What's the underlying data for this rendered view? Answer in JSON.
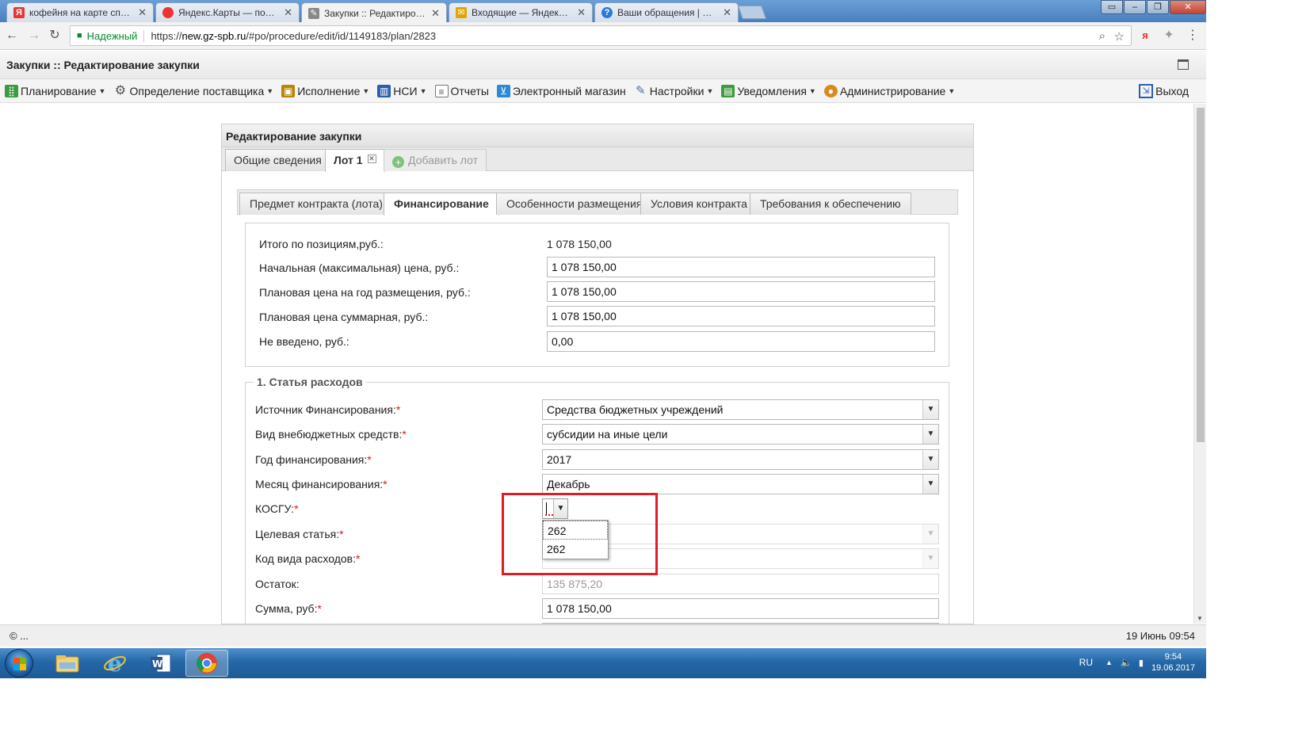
{
  "browser": {
    "tabs": [
      {
        "title": "кофейня на карте спб –",
        "fav_color": "#e33",
        "fav_glyph": "Я"
      },
      {
        "title": "Яндекс.Карты — подро",
        "fav_color": "#e33",
        "fav_glyph": "●"
      },
      {
        "title": "Закупки :: Редактирован",
        "fav_color": "#888",
        "fav_glyph": "✎",
        "active": true
      },
      {
        "title": "Входящие — Яндекс.По",
        "fav_color": "#e2a400",
        "fav_glyph": "✉"
      },
      {
        "title": "Ваши обращения | Help",
        "fav_color": "#2a7ad5",
        "fav_glyph": "?"
      }
    ],
    "secure_label": "Надежный",
    "url_scheme": "https://",
    "url_host": "new.gz-spb.ru",
    "url_path": "/#po/procedure/edit/id/1149183/plan/2823"
  },
  "app": {
    "title": "Закупки :: Редактирование закупки",
    "menu": [
      {
        "label": "Планирование",
        "icon": "planning-icon",
        "color": "#3f9a3f",
        "caret": true
      },
      {
        "label": "Определение поставщика",
        "icon": "gear-icon",
        "color": "#555",
        "caret": true
      },
      {
        "label": "Исполнение",
        "icon": "execution-icon",
        "color": "#b8860b",
        "caret": true
      },
      {
        "label": "НСИ",
        "icon": "book-icon",
        "color": "#2a5db0",
        "caret": true
      },
      {
        "label": "Отчеты",
        "icon": "report-icon",
        "color": "#6a6a6a",
        "caret": false
      },
      {
        "label": "Электронный магазин",
        "icon": "cart-icon",
        "color": "#2a8ad5",
        "caret": false
      },
      {
        "label": "Настройки",
        "icon": "wrench-icon",
        "color": "#4a6fa5",
        "caret": true
      },
      {
        "label": "Уведомления",
        "icon": "notification-icon",
        "color": "#3f9a3f",
        "caret": true
      },
      {
        "label": "Администрирование",
        "icon": "user-icon",
        "color": "#d98a1f",
        "caret": true
      }
    ],
    "logout_label": "Выход"
  },
  "panel": {
    "title": "Редактирование закупки",
    "lot_tabs": {
      "general": "Общие сведения",
      "lot1": "Лот 1",
      "add_lot": "Добавить лот"
    },
    "sub_tabs": [
      "Предмет контракта (лота)",
      "Финансирование",
      "Особенности размещения",
      "Условия контракта",
      "Требования к обеспечению"
    ],
    "totals": {
      "items_total_label": "Итого по позициям,руб.:",
      "items_total_value": "1 078 150,00",
      "nmc_label": "Начальная (максимальная) цена, руб.:",
      "nmc_value": "1 078 150,00",
      "plan_year_label": "Плановая цена на год размещения, руб.:",
      "plan_year_value": "1 078 150,00",
      "plan_total_label": "Плановая цена суммарная, руб.:",
      "plan_total_value": "1 078 150,00",
      "not_entered_label": "Не введено, руб.:",
      "not_entered_value": "0,00"
    },
    "expense": {
      "legend": "1. Статья расходов",
      "source_label": "Источник Финансирования:",
      "source_value": "Средства бюджетных учреждений",
      "offbudget_label": "Вид внебюджетных средств:",
      "offbudget_value": "субсидии на иные цели",
      "year_label": "Год финансирования:",
      "year_value": "2017",
      "month_label": "Месяц финансирования:",
      "month_value": "Декабрь",
      "kosgu_label": "КОСГУ:",
      "kosgu_options": [
        "262",
        "262"
      ],
      "target_label": "Целевая статья:",
      "expense_code_label": "Код вида расходов:",
      "balance_label": "Остаток:",
      "balance_value": "135 875,20",
      "sum_label": "Сумма, руб:",
      "sum_value": "1 078 150,00"
    },
    "required_mark": "*"
  },
  "statusbar": {
    "left": "© ...",
    "right": "19 Июнь 09:54"
  },
  "taskbar": {
    "lang": "RU",
    "time": "9:54",
    "date": "19.06.2017"
  }
}
